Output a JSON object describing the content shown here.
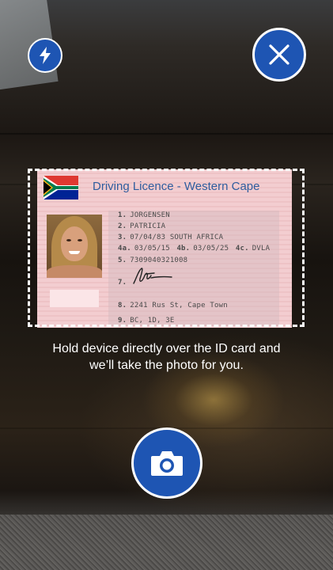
{
  "controls": {
    "flash_icon": "lightning-bolt",
    "close_icon": "close-x",
    "capture_icon": "camera"
  },
  "colors": {
    "button_fill": "#1e55b3",
    "card_tint": "#f3cdd0",
    "card_title": "#2f5d9e"
  },
  "card": {
    "title": "Driving Licence - Western Cape",
    "fields": [
      {
        "num": "1.",
        "text": "JORGENSEN"
      },
      {
        "num": "2.",
        "text": "PATRICIA"
      },
      {
        "num": "3.",
        "text": "07/04/83 SOUTH AFRICA"
      },
      {
        "num": "4a.",
        "text": "03/05/15",
        "num2": "4b.",
        "text2": "03/05/25",
        "num3": "4c.",
        "text3": "DVLA"
      },
      {
        "num": "5.",
        "text": "7309040321008"
      },
      {
        "num": "7.",
        "text": ""
      },
      {
        "num": "8.",
        "text": "2241  Rus St, Cape Town"
      },
      {
        "num": "9.",
        "text": "BC, 1D, 3E"
      }
    ]
  },
  "instruction": {
    "line1": "Hold device directly over the ID card and",
    "line2": "we’ll take the photo for you."
  }
}
